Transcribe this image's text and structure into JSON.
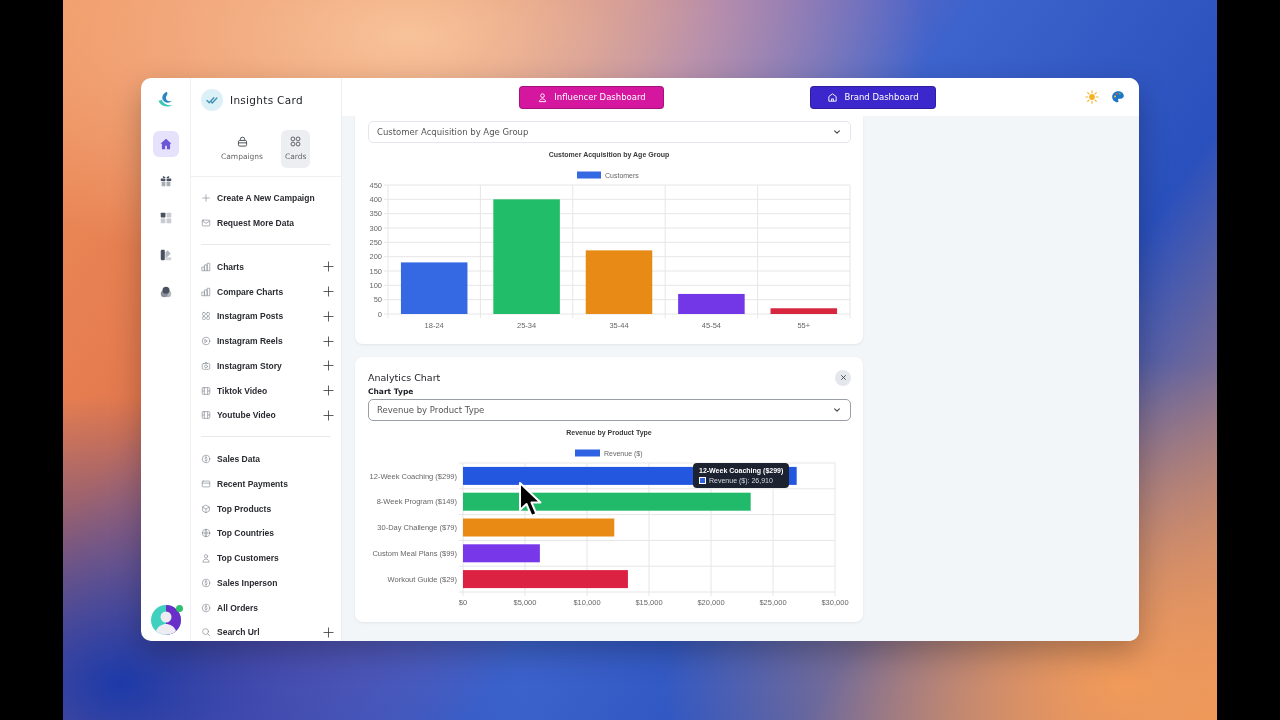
{
  "rail": {
    "items": [
      {
        "selected": true
      },
      {
        "selected": false
      },
      {
        "selected": false
      },
      {
        "selected": false
      },
      {
        "selected": false
      }
    ]
  },
  "avatar": {
    "online": true
  },
  "sidebar": {
    "title": "Insights Card",
    "tabs": [
      {
        "label": "Campaigns",
        "selected": false
      },
      {
        "label": "Cards",
        "selected": true
      }
    ],
    "groups": [
      {
        "items": [
          {
            "label": "Create A New Campaign",
            "add_button": false
          },
          {
            "label": "Request More Data",
            "add_button": false
          }
        ]
      },
      {
        "items": [
          {
            "label": "Charts",
            "add_button": true
          },
          {
            "label": "Compare Charts",
            "add_button": true
          },
          {
            "label": "Instagram Posts",
            "add_button": true
          },
          {
            "label": "Instagram Reels",
            "add_button": true
          },
          {
            "label": "Instagram Story",
            "add_button": true
          },
          {
            "label": "Tiktok Video",
            "add_button": true
          },
          {
            "label": "Youtube Video",
            "add_button": true
          }
        ]
      },
      {
        "items": [
          {
            "label": "Sales Data",
            "add_button": false
          },
          {
            "label": "Recent Payments",
            "add_button": false
          },
          {
            "label": "Top Products",
            "add_button": false
          },
          {
            "label": "Top Countries",
            "add_button": false
          },
          {
            "label": "Top Customers",
            "add_button": false
          },
          {
            "label": "Sales Inperson",
            "add_button": false
          },
          {
            "label": "All Orders",
            "add_button": false
          },
          {
            "label": "Search Url",
            "add_button": true
          }
        ]
      }
    ]
  },
  "top_bar": {
    "buttons": [
      {
        "label": "Influencer Dashboard",
        "color": "#d4179e"
      },
      {
        "label": "Brand Dashboard",
        "color": "#3b27cb"
      }
    ]
  },
  "cards": [
    {
      "dropdown": {
        "value": "Customer Acquisition by Age Group",
        "focused": false
      },
      "chart_data": {
        "type": "bar",
        "title": "Customer Acquisition by Age Group",
        "categories": [
          "18-24",
          "25-34",
          "35-44",
          "45-54",
          "55+"
        ],
        "series": [
          {
            "name": "Customers",
            "color": "#3569e4",
            "colors": [
              "#3569e4",
              "#21bd68",
              "#e78a16",
              "#7437e8",
              "#d6273e"
            ],
            "values": [
              180,
              400,
              222,
              70,
              20
            ]
          }
        ],
        "ylim": [
          0,
          450
        ],
        "yticks": [
          0,
          50,
          100,
          150,
          200,
          250,
          300,
          350,
          400,
          450
        ],
        "grid": true
      }
    },
    {
      "title": "Analytics Chart",
      "label": "Chart Type",
      "closable": true,
      "dropdown": {
        "value": "Revenue by Product Type",
        "focused": true
      },
      "chart_data": {
        "type": "bar",
        "orientation": "horizontal",
        "title": "Revenue by Product Type",
        "categories": [
          "12-Week Coaching ($299)",
          "8-Week Program ($149)",
          "30-Day Challenge ($79)",
          "Custom Meal Plans ($99)",
          "Workout Guide ($29)"
        ],
        "series": [
          {
            "name": "Revenue ($)",
            "color": "#2f62e3",
            "colors": [
              "#2457e0",
              "#21b96a",
              "#e88a14",
              "#7837e8",
              "#dc2242"
            ],
            "values": [
              26910,
              23200,
              12200,
              6200,
              13300
            ]
          }
        ],
        "xlim": [
          0,
          30000
        ],
        "xticks": [
          {
            "value": 0,
            "label": "$0"
          },
          {
            "value": 5000,
            "label": "$5,000"
          },
          {
            "value": 10000,
            "label": "$10,000"
          },
          {
            "value": 15000,
            "label": "$15,000"
          },
          {
            "value": 20000,
            "label": "$20,000"
          },
          {
            "value": 25000,
            "label": "$25,000"
          },
          {
            "value": 30000,
            "label": "$30,000"
          }
        ],
        "grid": true
      },
      "tooltip": {
        "title": "12-Week Coaching ($299)",
        "label": "Revenue ($): 26,910"
      }
    }
  ]
}
